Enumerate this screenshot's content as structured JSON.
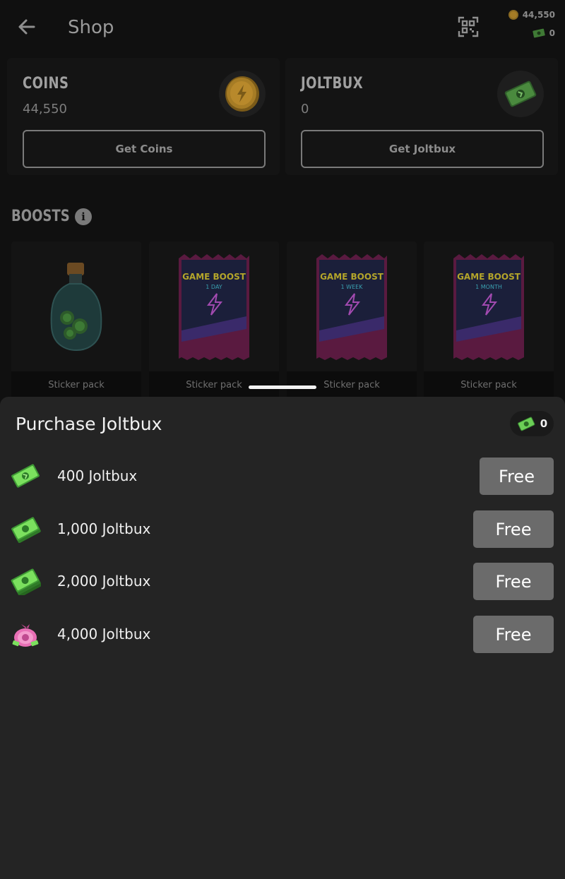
{
  "header": {
    "title": "Shop",
    "wallet": {
      "coins": "44,550",
      "joltbux": "0"
    }
  },
  "cards": {
    "coins": {
      "label": "COINS",
      "value": "44,550",
      "button": "Get Coins"
    },
    "joltbux": {
      "label": "JOLTBUX",
      "value": "0",
      "button": "Get Joltbux"
    }
  },
  "boosts": {
    "title": "BOOSTS",
    "items": [
      {
        "label": "Sticker pack",
        "art": "potion-bottle"
      },
      {
        "label": "Sticker pack",
        "art": "game-boost-pack",
        "pack_title": "GAME BOOST",
        "pack_duration": "1 DAY"
      },
      {
        "label": "Sticker pack",
        "art": "game-boost-pack",
        "pack_title": "GAME BOOST",
        "pack_duration": "1 WEEK"
      },
      {
        "label": "Sticker pack",
        "art": "game-boost-pack",
        "pack_title": "GAME BOOST",
        "pack_duration": "1 MONTH"
      }
    ]
  },
  "sheet": {
    "title": "Purchase Joltbux",
    "balance": "0",
    "options": [
      {
        "label": "400 Joltbux",
        "button": "Free",
        "icon": "joltbux-bill-icon"
      },
      {
        "label": "1,000 Joltbux",
        "button": "Free",
        "icon": "joltbux-stack-icon"
      },
      {
        "label": "2,000 Joltbux",
        "button": "Free",
        "icon": "joltbux-stack-icon"
      },
      {
        "label": "4,000 Joltbux",
        "button": "Free",
        "icon": "joltbux-bag-icon"
      }
    ]
  },
  "colors": {
    "background": "#101010",
    "sheet": "#242424",
    "free_button": "#6b6b6b",
    "coin_gold": "#c9962a",
    "joltbux_green": "#5fc44f",
    "bag_pink": "#e86fb5"
  }
}
